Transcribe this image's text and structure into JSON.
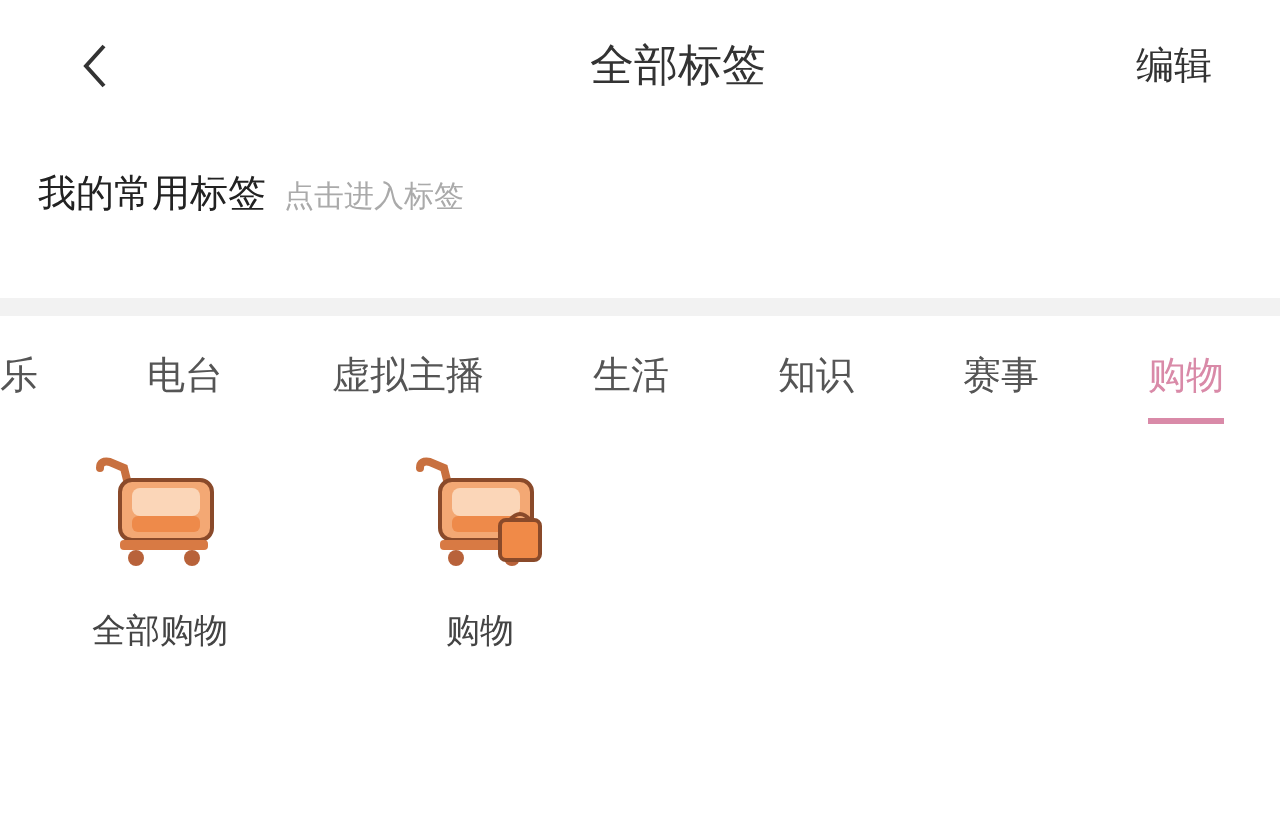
{
  "header": {
    "title": "全部标签",
    "action": "编辑"
  },
  "favorites": {
    "title": "我的常用标签",
    "hint": "点击进入标签"
  },
  "tabs": [
    {
      "label": "乐",
      "selected": false
    },
    {
      "label": "电台",
      "selected": false
    },
    {
      "label": "虚拟主播",
      "selected": false
    },
    {
      "label": "生活",
      "selected": false
    },
    {
      "label": "知识",
      "selected": false
    },
    {
      "label": "赛事",
      "selected": false
    },
    {
      "label": "购物",
      "selected": true
    }
  ],
  "items": [
    {
      "label": "全部购物",
      "kind": "cart"
    },
    {
      "label": "购物",
      "kind": "cart-bag"
    }
  ]
}
